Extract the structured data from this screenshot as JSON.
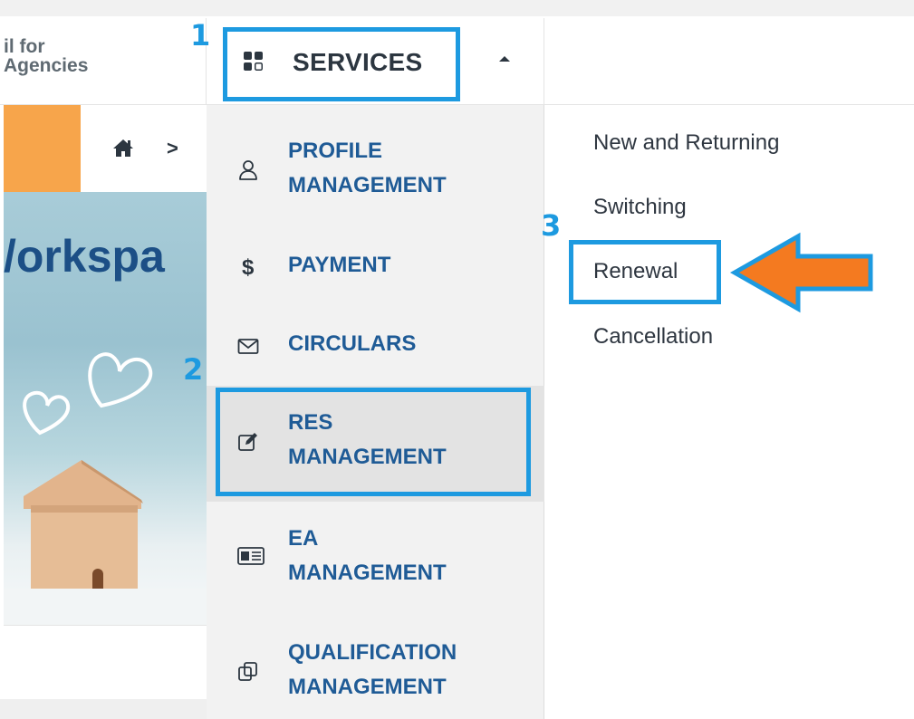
{
  "header": {
    "logo_line1": "il for",
    "logo_line2": "Agencies",
    "services_label": "SERVICES"
  },
  "breadcrumb": {
    "separator": ">"
  },
  "hero": {
    "title": "/orkspa"
  },
  "menu": {
    "items": [
      {
        "icon": "user-icon",
        "line1": "PROFILE",
        "line2": "MANAGEMENT"
      },
      {
        "icon": "dollar-icon",
        "line1": "PAYMENT",
        "line2": ""
      },
      {
        "icon": "envelope-icon",
        "line1": "CIRCULARS",
        "line2": ""
      },
      {
        "icon": "edit-icon",
        "line1": "RES",
        "line2": "MANAGEMENT"
      },
      {
        "icon": "id-card-icon",
        "line1": "EA",
        "line2": "MANAGEMENT"
      },
      {
        "icon": "copy-icon",
        "line1": "QUALIFICATION",
        "line2": "MANAGEMENT"
      }
    ]
  },
  "submenu": {
    "items": [
      "New and Returning",
      "Switching",
      "Renewal",
      "Cancellation"
    ]
  },
  "annotations": {
    "step1": "1",
    "step2": "2",
    "step3": "3"
  },
  "colors": {
    "highlight": "#1d9ae0",
    "arrow": "#f47a20",
    "accent_orange": "#f7a54b",
    "menu_text": "#1f5b96"
  }
}
